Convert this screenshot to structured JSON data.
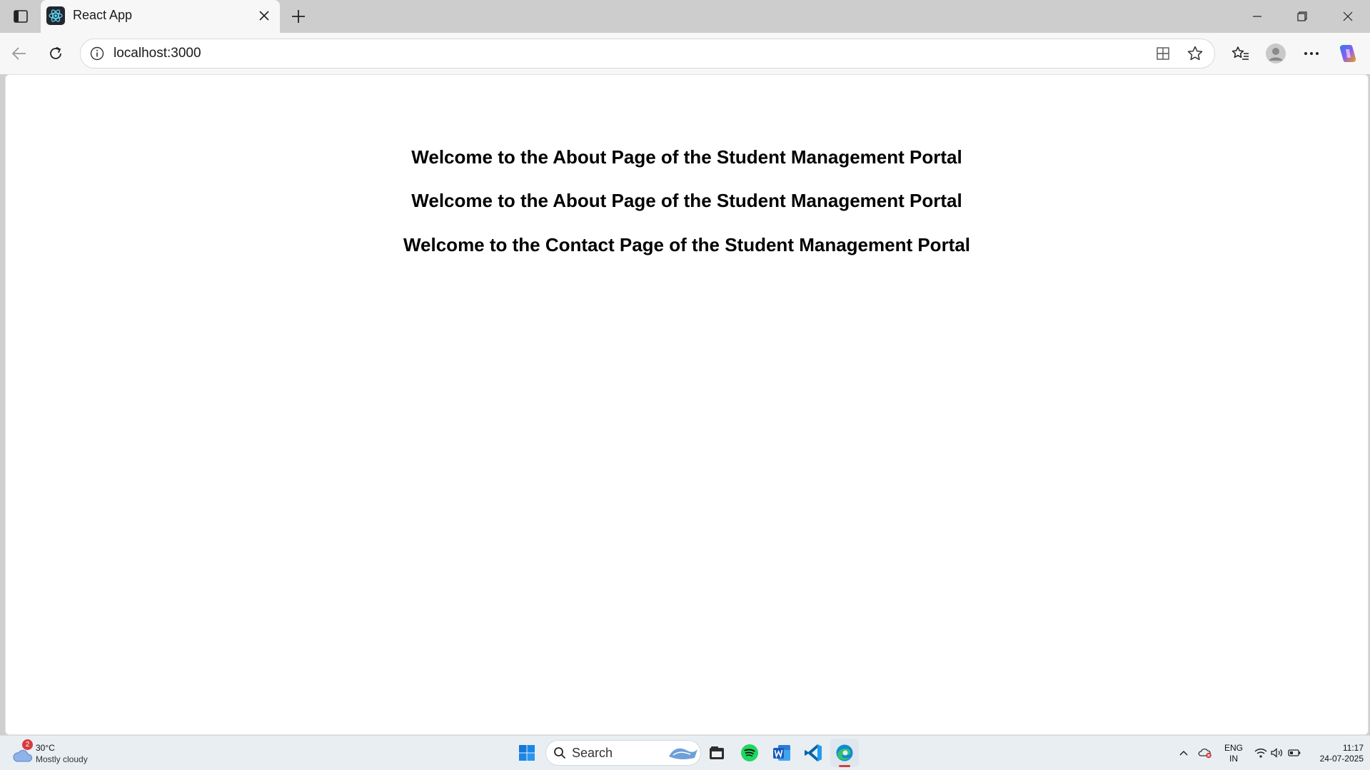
{
  "browser": {
    "tab": {
      "title": "React App",
      "favicon": "react-atom-icon"
    },
    "address_bar": {
      "url": "localhost:3000"
    }
  },
  "page": {
    "headings": [
      "Welcome to the About Page of the Student Management Portal",
      "Welcome to the About Page of the Student Management Portal",
      "Welcome to the Contact Page of the Student Management Portal"
    ]
  },
  "taskbar": {
    "weather": {
      "temp": "30°C",
      "desc": "Mostly cloudy",
      "badge": "2"
    },
    "search_label": "Search",
    "tray": {
      "lang_line1": "ENG",
      "lang_line2": "IN",
      "time": "11:17",
      "date": "24-07-2025"
    }
  },
  "colors": {
    "edge_blue": "#0078d4",
    "vscode_blue": "#0065a9",
    "spotify_green": "#1ed760",
    "word_blue": "#185abd"
  }
}
